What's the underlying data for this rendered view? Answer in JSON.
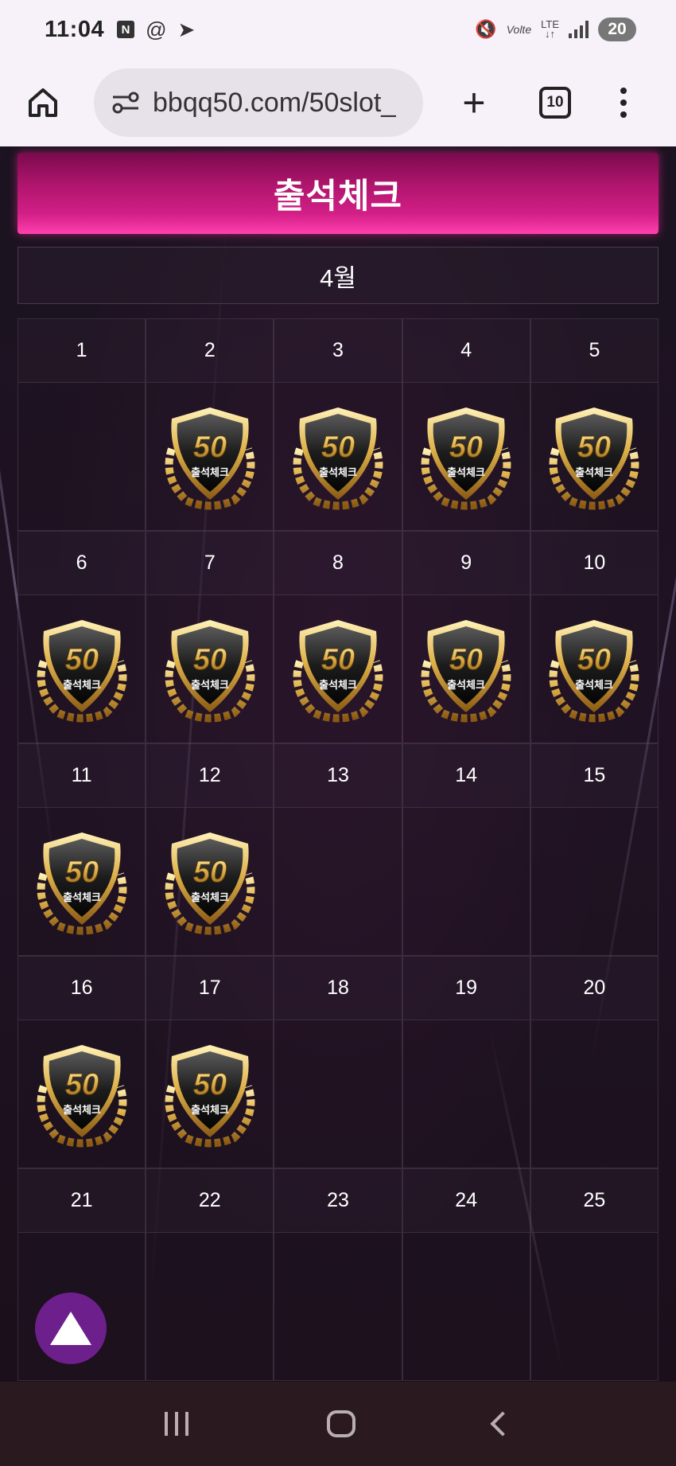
{
  "status_bar": {
    "time": "11:04",
    "n_icon": "N",
    "threads_icon": "@",
    "telegram_icon": "➤",
    "mute_icon": "🔇",
    "volte": "Volte",
    "lte": "LTE",
    "battery": "20"
  },
  "browser": {
    "url": "bbqq50.com/50slot_",
    "tab_count": "10",
    "new_tab": "+"
  },
  "page": {
    "title": "출석체크",
    "month": "4월",
    "badge_number": "50",
    "badge_label": "출석체크",
    "days": [
      {
        "day": "1",
        "checked": false
      },
      {
        "day": "2",
        "checked": true
      },
      {
        "day": "3",
        "checked": true
      },
      {
        "day": "4",
        "checked": true
      },
      {
        "day": "5",
        "checked": true
      },
      {
        "day": "6",
        "checked": true
      },
      {
        "day": "7",
        "checked": true
      },
      {
        "day": "8",
        "checked": true
      },
      {
        "day": "9",
        "checked": true
      },
      {
        "day": "10",
        "checked": true
      },
      {
        "day": "11",
        "checked": true
      },
      {
        "day": "12",
        "checked": true
      },
      {
        "day": "13",
        "checked": false
      },
      {
        "day": "14",
        "checked": false
      },
      {
        "day": "15",
        "checked": false
      },
      {
        "day": "16",
        "checked": true
      },
      {
        "day": "17",
        "checked": true
      },
      {
        "day": "18",
        "checked": false
      },
      {
        "day": "19",
        "checked": false
      },
      {
        "day": "20",
        "checked": false
      },
      {
        "day": "21",
        "checked": false
      },
      {
        "day": "22",
        "checked": false
      },
      {
        "day": "23",
        "checked": false
      },
      {
        "day": "24",
        "checked": false
      },
      {
        "day": "25",
        "checked": false
      }
    ]
  },
  "colors": {
    "banner_pink": "#d21f86",
    "top_button": "#6d1f8c",
    "badge_gold": "#e0b24a"
  }
}
